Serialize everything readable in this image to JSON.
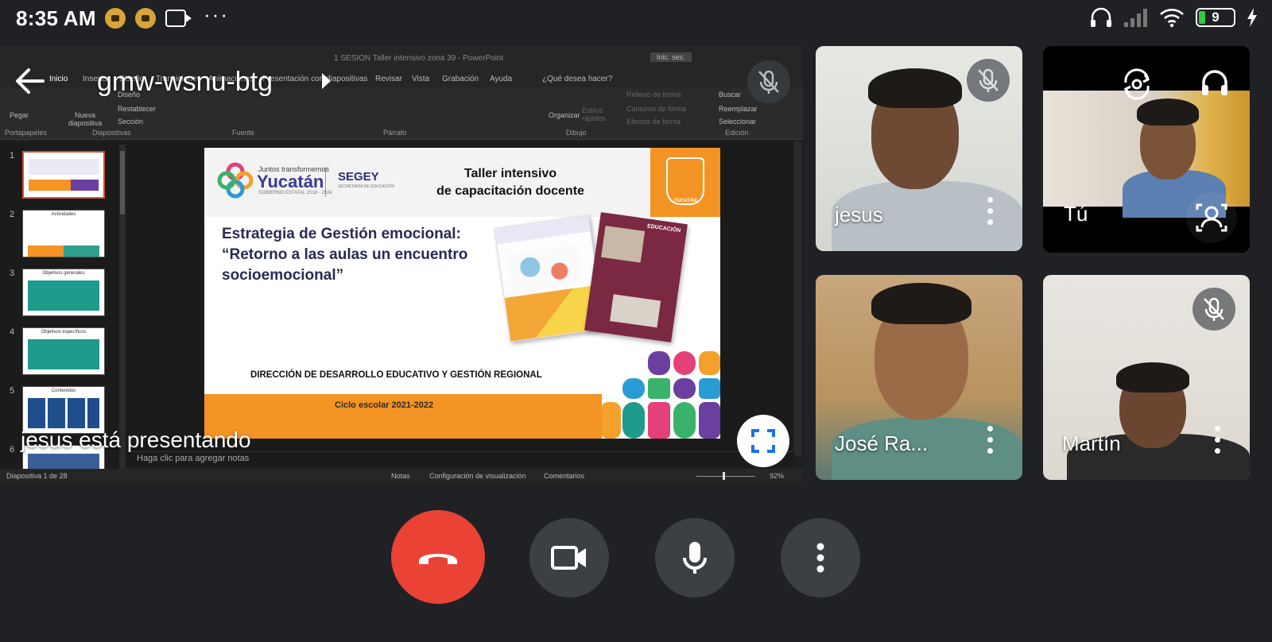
{
  "status_bar": {
    "time": "8:35 AM",
    "battery": "9",
    "more": "···"
  },
  "meeting": {
    "code": "gmw-wsnu-btg",
    "presenting_label": "jesus está presentando"
  },
  "powerpoint": {
    "window_title": "1 SESION Taller intensivo zona 39  -  PowerPoint",
    "login_button": "Inic. ses.",
    "ribbon_tabs": [
      "Inicio",
      "Insertar",
      "Diseño",
      "Transiciones",
      "Animaciones",
      "Presentación con diapositivas",
      "Revisar",
      "Vista",
      "Grabación",
      "Ayuda",
      "¿Qué desea hacer?"
    ],
    "ribbon_groups": [
      "Portapapeles",
      "Diapositivas",
      "Fuente",
      "Párrafo",
      "Dibujo",
      "Edición"
    ],
    "ribbon_commands": {
      "paste": "Pegar",
      "new_slide": "Nueva diapositiva",
      "layout": "Diseño",
      "reset": "Restablecer",
      "section": "Sección",
      "arrange": "Organizar",
      "quick_styles": "Estilos rápidos",
      "shape_fill": "Relleno de forma",
      "shape_outline": "Contorno de forma",
      "shape_effects": "Efectos de forma",
      "find": "Buscar",
      "replace": "Reemplazar",
      "select": "Seleccionar"
    },
    "thumbnail_numbers": [
      "1",
      "2",
      "3",
      "4",
      "5",
      "6"
    ],
    "thumbnail_titles": [
      "",
      "Actividades",
      "Objetivos generales",
      "Objetivos específicos",
      "Contenidos",
      ""
    ],
    "notes_placeholder": "Haga clic para agregar notas",
    "status": {
      "slide_counter": "Diapositiva 1 de 28",
      "notes": "Notas",
      "display_settings": "Configuración de visualización",
      "comments": "Comentarios",
      "zoom": "92%"
    }
  },
  "slide": {
    "logo_tagline": "Juntos transformemos",
    "logo_name": "Yucatán",
    "logo_gov": "GOBIERNO ESTATAL 2018 - 2024",
    "agency": "SEGEY",
    "agency_sub": "SECRETARÍA DE EDUCACIÓN",
    "title_line1": "Taller intensivo",
    "title_line2": "de capacitación docente",
    "seal_label": "YUCATÁN",
    "heading_line1": "Estrategia de Gestión emocional:",
    "heading_line2": "“Retorno a las aulas un encuentro",
    "heading_line3": "socioemocional”",
    "book2_label": "EDUCACIÓN",
    "direction": "DIRECCIÓN DE DESARROLLO EDUCATIVO Y GESTIÓN REGIONAL",
    "school_year": "Ciclo escolar 2021-2022"
  },
  "participants": [
    {
      "name": "jesus",
      "mic_muted": true
    },
    {
      "name": "José Ra...",
      "mic_muted": false
    },
    {
      "name": "Martín",
      "mic_muted": true
    }
  ],
  "self": {
    "name": "Tú"
  },
  "colors": {
    "end_call": "#ea4335",
    "control_bg": "#3c4043",
    "background": "#202124"
  }
}
